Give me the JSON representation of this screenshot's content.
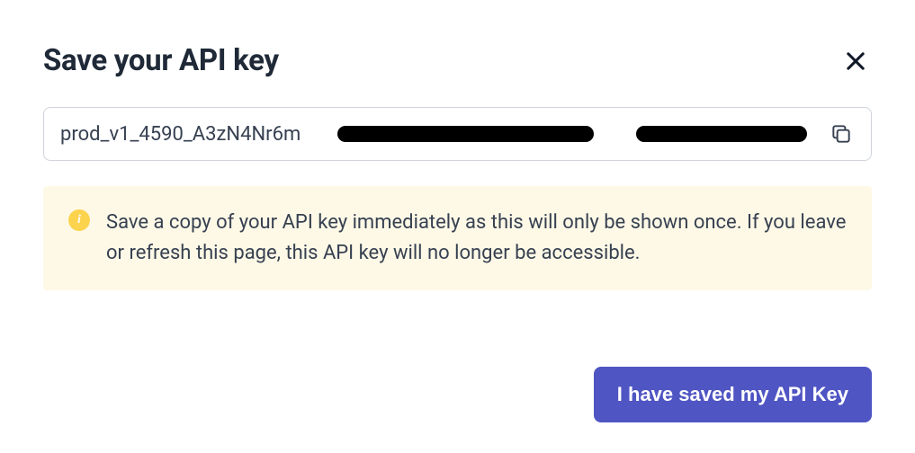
{
  "dialog": {
    "title": "Save your API key",
    "api_key_visible": "prod_v1_4590_A3zN4Nr6m",
    "notice": "Save a copy of your API key immediately as this will only be shown once. If you leave or refresh this page, this API key will no longer be accessible.",
    "confirm_label": "I have saved my API Key"
  }
}
